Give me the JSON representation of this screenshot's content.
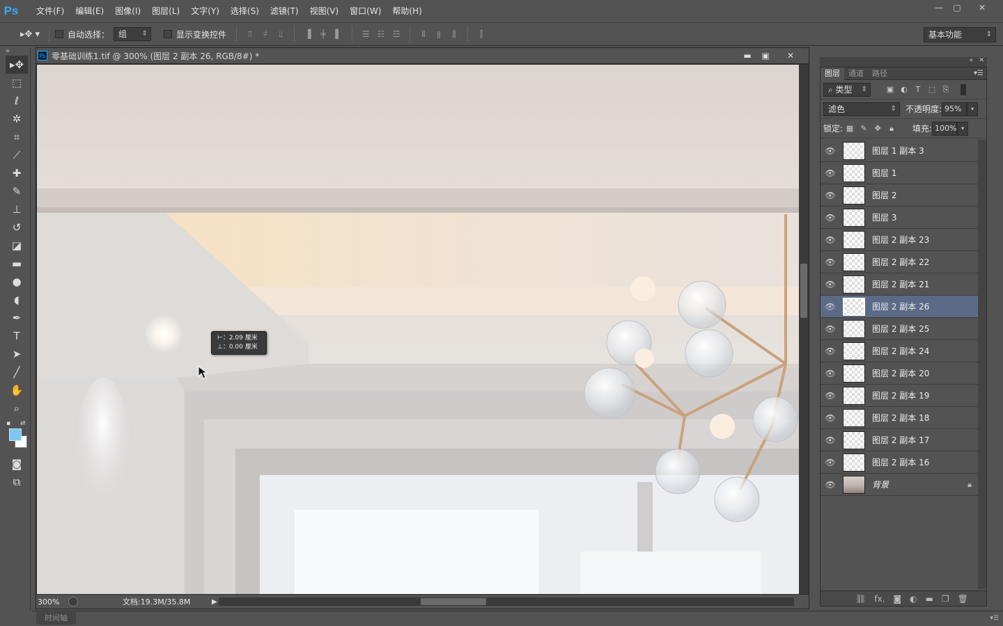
{
  "app": {
    "logo": "Ps"
  },
  "menu": [
    "文件(F)",
    "编辑(E)",
    "图像(I)",
    "图层(L)",
    "文字(Y)",
    "选择(S)",
    "滤镜(T)",
    "视图(V)",
    "窗口(W)",
    "帮助(H)"
  ],
  "window_controls": [
    "—",
    "▢",
    "✕"
  ],
  "options": {
    "auto_select_label": "自动选择：",
    "auto_select_value": "组",
    "show_transform_label": "显示变换控件",
    "workspace": "基本功能"
  },
  "document": {
    "title": "零基础训练1.tif @ 300% (图层 2 副本 26, RGB/8#) *",
    "zoom": "300%",
    "doc_info": "文档:19.3M/35.8M"
  },
  "measure": {
    "line1": "⊢：2.09 厘米",
    "line2": "⊥：0.00 厘米"
  },
  "layers_panel": {
    "tabs": [
      "图层",
      "通道",
      "路径"
    ],
    "filter_kind": "类型",
    "blend_mode": "滤色",
    "opacity_label": "不透明度:",
    "opacity": "95%",
    "lock_label": "锁定:",
    "fill_label": "填充:",
    "fill": "100%",
    "layers": [
      {
        "name": "图层 1 副本 3",
        "selected": false
      },
      {
        "name": "图层 1",
        "selected": false
      },
      {
        "name": "图层 2",
        "selected": false
      },
      {
        "name": "图层 3",
        "selected": false
      },
      {
        "name": "图层 2 副本 23",
        "selected": false
      },
      {
        "name": "图层 2 副本 22",
        "selected": false
      },
      {
        "name": "图层 2 副本 21",
        "selected": false
      },
      {
        "name": "图层 2 副本 26",
        "selected": true
      },
      {
        "name": "图层 2 副本 25",
        "selected": false
      },
      {
        "name": "图层 2 副本 24",
        "selected": false
      },
      {
        "name": "图层 2 副本 20",
        "selected": false
      },
      {
        "name": "图层 2 副本 19",
        "selected": false
      },
      {
        "name": "图层 2 副本 18",
        "selected": false
      },
      {
        "name": "图层 2 副本 17",
        "selected": false
      },
      {
        "name": "图层 2 副本 16",
        "selected": false
      },
      {
        "name": "背景",
        "selected": false,
        "background": true
      }
    ]
  },
  "timeline": {
    "label": "时间轴"
  },
  "colors": {
    "foreground": "#7dc6f2",
    "background": "#ffffff",
    "selected_layer": "#5b6b87",
    "ps_blue": "#31a8ff"
  }
}
